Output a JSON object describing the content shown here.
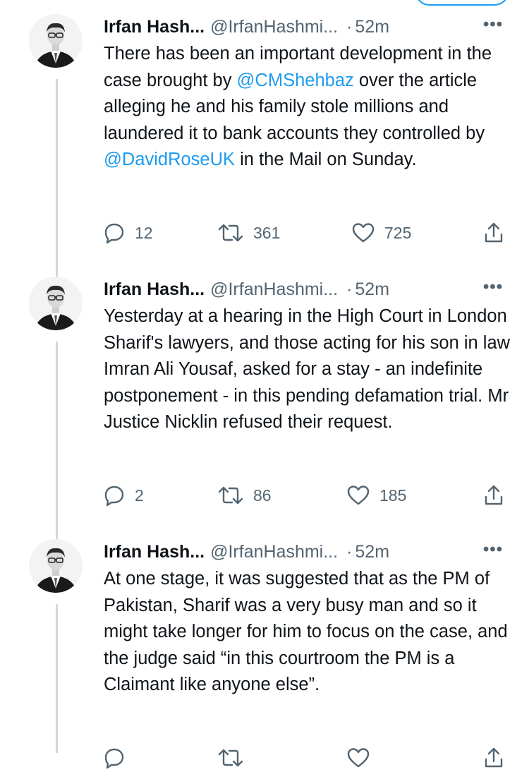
{
  "colors": {
    "text": "#0f1419",
    "muted": "#536471",
    "mention": "#1d9bf0",
    "thread_line": "#cfd9de"
  },
  "tweets": [
    {
      "author_name": "Irfan Hash...",
      "handle": "@IrfanHashmi...",
      "separator": "·",
      "time": "52m",
      "more_icon": "ellipsis-icon",
      "segments": [
        {
          "text": "There has been an important development in the case brought by ",
          "mention": false
        },
        {
          "text": "@CMShehbaz",
          "mention": true
        },
        {
          "text": " over the article alleging he and his family stole millions and laundered it to bank accounts they controlled by ",
          "mention": false
        },
        {
          "text": "@DavidRoseUK",
          "mention": true
        },
        {
          "text": " in the Mail on Sunday.",
          "mention": false
        }
      ],
      "stats": {
        "replies": "12",
        "retweets": "361",
        "likes": "725"
      }
    },
    {
      "author_name": "Irfan Hash...",
      "handle": "@IrfanHashmi...",
      "separator": "·",
      "time": "52m",
      "more_icon": "ellipsis-icon",
      "segments": [
        {
          "text": "Yesterday at a hearing in the High Court in London Sharif's lawyers, and those acting for his son in law Imran Ali Yousaf, asked for a stay - an indefinite postponement - in this pending defamation trial. Mr Justice Nicklin refused their request.",
          "mention": false
        }
      ],
      "stats": {
        "replies": "2",
        "retweets": "86",
        "likes": "185"
      }
    },
    {
      "author_name": "Irfan Hash...",
      "handle": "@IrfanHashmi...",
      "separator": "·",
      "time": "52m",
      "more_icon": "ellipsis-icon",
      "segments": [
        {
          "text": "At one stage,  it was suggested that as the PM of Pakistan, Sharif was a very busy man and so it might take longer for him to focus on the case, and the judge said “in this courtroom the PM is a Claimant like anyone else”.",
          "mention": false
        }
      ],
      "stats": {
        "replies": "",
        "retweets": "",
        "likes": ""
      }
    }
  ]
}
